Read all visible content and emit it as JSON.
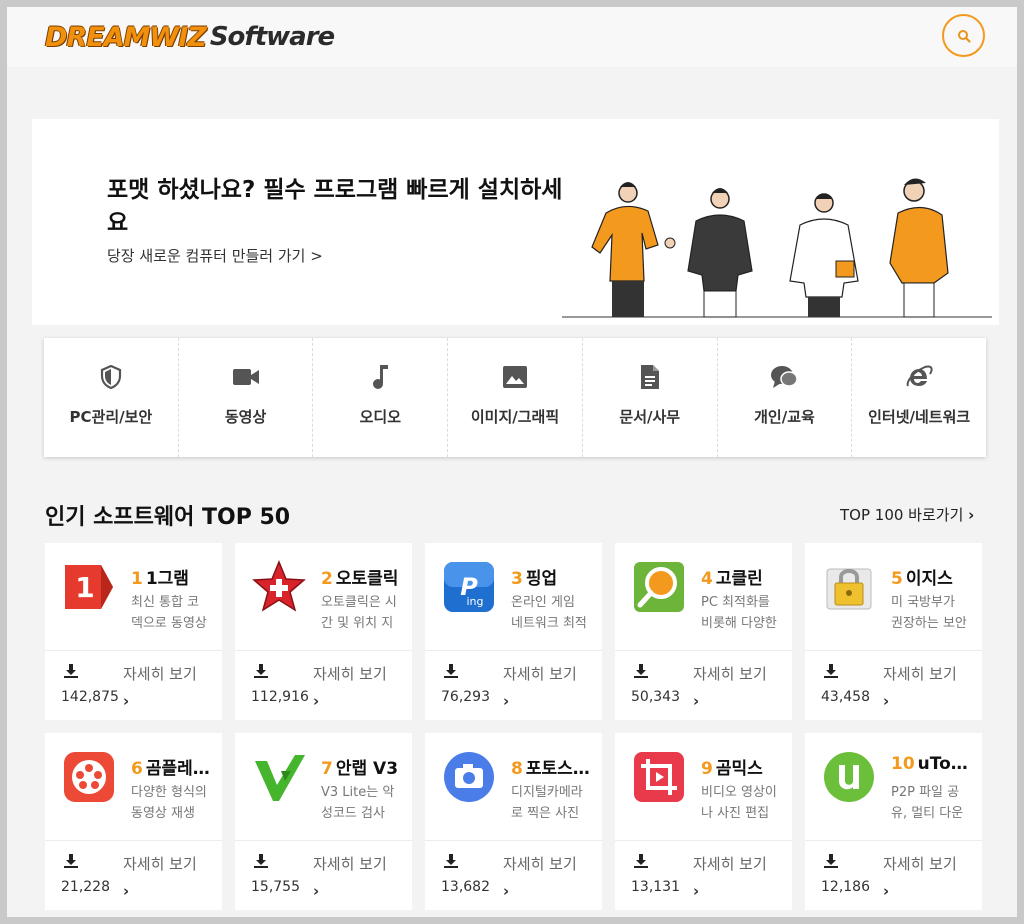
{
  "header": {
    "logo_part1": "DREAMWIZ",
    "logo_part2": "Software",
    "search_icon": "search-icon"
  },
  "banner": {
    "title": "포맷 하셨나요? 필수 프로그램 빠르게 설치하세요",
    "link": "당장 새로운 컴퓨터 만들러 가기 >"
  },
  "categories": [
    {
      "label": "PC관리/보안",
      "icon": "shield-icon"
    },
    {
      "label": "동영상",
      "icon": "video-camera-icon"
    },
    {
      "label": "오디오",
      "icon": "music-note-icon"
    },
    {
      "label": "이미지/그래픽",
      "icon": "image-icon"
    },
    {
      "label": "문서/사무",
      "icon": "document-icon"
    },
    {
      "label": "개인/교육",
      "icon": "chat-bubbles-icon"
    },
    {
      "label": "인터넷/네트워크",
      "icon": "internet-explorer-icon"
    }
  ],
  "section": {
    "title": "인기 소프트웨어 TOP 50",
    "more": "TOP 100 바로가기"
  },
  "cards": [
    {
      "rank": "1",
      "name": "1그램",
      "desc": "최신 통합 코덱으로 동영상 재생",
      "count": "142,875",
      "detail": "자세히 보기",
      "icon": "1gram-app-icon"
    },
    {
      "rank": "2",
      "name": "오토클릭",
      "desc": "오토클릭은 시간 및 위치 지정",
      "count": "112,916",
      "detail": "자세히 보기",
      "icon": "autoclick-star-icon"
    },
    {
      "rank": "3",
      "name": "핑업",
      "desc": "온라인 게임 네트워크 최적화",
      "count": "76,293",
      "detail": "자세히 보기",
      "icon": "pingup-ping-icon"
    },
    {
      "rank": "4",
      "name": "고클린",
      "desc": "PC 최적화를 비롯해 다양한",
      "count": "50,343",
      "detail": "자세히 보기",
      "icon": "goclean-magnifier-icon"
    },
    {
      "rank": "5",
      "name": "이지스",
      "desc": "미 국방부가 권장하는 보안",
      "count": "43,458",
      "detail": "자세히 보기",
      "icon": "lock-folder-icon"
    },
    {
      "rank": "6",
      "name": "곰플레이어",
      "desc": "다양한 형식의 동영상 재생",
      "count": "21,228",
      "detail": "자세히 보기",
      "icon": "gomplayer-reel-icon"
    },
    {
      "rank": "7",
      "name": "안랩 V3",
      "desc": "V3 Lite는 악성코드 검사",
      "count": "15,755",
      "detail": "자세히 보기",
      "icon": "v3-checkmark-icon"
    },
    {
      "rank": "8",
      "name": "포토스케이프",
      "desc": "디지털카메라로 찍은 사진",
      "count": "13,682",
      "detail": "자세히 보기",
      "icon": "camera-app-icon"
    },
    {
      "rank": "9",
      "name": "곰믹스",
      "desc": "비디오 영상이나 사진 편집",
      "count": "13,131",
      "detail": "자세히 보기",
      "icon": "crop-frame-icon"
    },
    {
      "rank": "10",
      "name": "uTorrent",
      "desc": "P2P 파일 공유, 멀티 다운",
      "count": "12,186",
      "detail": "자세히 보기",
      "icon": "utorrent-icon"
    }
  ],
  "colors": {
    "accent": "#f39a1e",
    "text": "#222222"
  }
}
